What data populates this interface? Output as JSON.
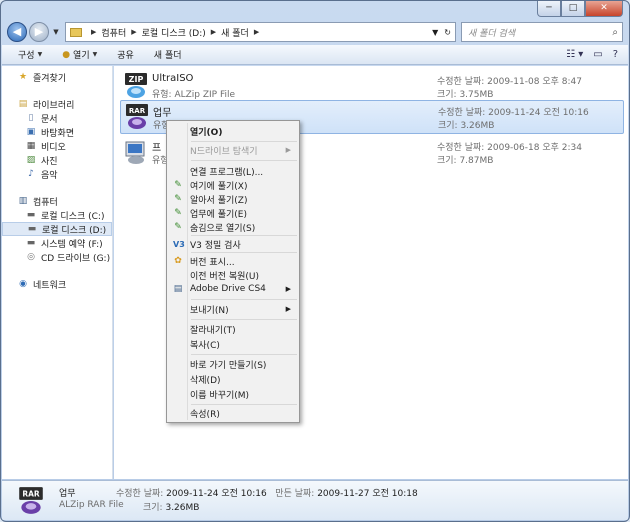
{
  "window": {
    "minimize": "─",
    "maximize": "□",
    "close": "✕"
  },
  "address": {
    "path": [
      "컴퓨터",
      "로컬 디스크 (D:)",
      "새 폴더"
    ],
    "search_placeholder": "새 폴더 검색"
  },
  "toolbar": {
    "organize": "구성",
    "open": "열기",
    "share": "공유",
    "new_folder": "새 폴더"
  },
  "sidebar": {
    "favorites": "즐겨찾기",
    "libraries": "라이브러리",
    "documents": "문서",
    "desktop": "바탕화면",
    "video": "비디오",
    "pictures": "사진",
    "music": "음악",
    "computer": "컴퓨터",
    "drive_c": "로컬 디스크 (C:)",
    "drive_d": "로컬 디스크 (D:)",
    "system_reserved": "시스템 예약 (F:)",
    "cd_drive": "CD 드라이브 (G:)",
    "network": "네트워크"
  },
  "files": [
    {
      "name": "UltraISO",
      "type": "유형: ALZip ZIP File",
      "modified": "수정한 날짜: 2009-11-08 오후 8:47",
      "size": "크기: 3.75MB"
    },
    {
      "name": "업무",
      "type": "유형",
      "modified": "수정한 날짜: 2009-11-24 오전 10:16",
      "size": "크기: 3.26MB"
    },
    {
      "name": "프",
      "type": "유형",
      "modified": "수정한 날짜: 2009-06-18 오후 2:34",
      "size": "크기: 7.87MB"
    }
  ],
  "context_menu": {
    "open": "열기(O)",
    "n_drive": "N드라이브 탐색기",
    "open_with": "연결 프로그램(L)...",
    "extract_here": "여기에 풀기(X)",
    "extract_auto": "알아서 풀기(Z)",
    "extract_folder": "업무에 풀기(E)",
    "extract_desktop": "숨김으로 열기(S)",
    "v3_scan": "V3 정밀 검사",
    "version_show": "버전 표시...",
    "restore_prev": "이전 버전 복원(U)",
    "adobe_drive": "Adobe Drive CS4",
    "send_to": "보내기(N)",
    "cut": "잘라내기(T)",
    "copy": "복사(C)",
    "create_shortcut": "바로 가기 만들기(S)",
    "delete": "삭제(D)",
    "rename": "이름 바꾸기(M)",
    "properties": "속성(R)"
  },
  "details": {
    "name": "업무",
    "type": "ALZip RAR File",
    "modified_label": "수정한 날짜:",
    "modified": "2009-11-24 오전 10:16",
    "created_label": "만든 날짜:",
    "created": "2009-11-27 오전 10:18",
    "size_label": "크기:",
    "size": "3.26MB"
  }
}
